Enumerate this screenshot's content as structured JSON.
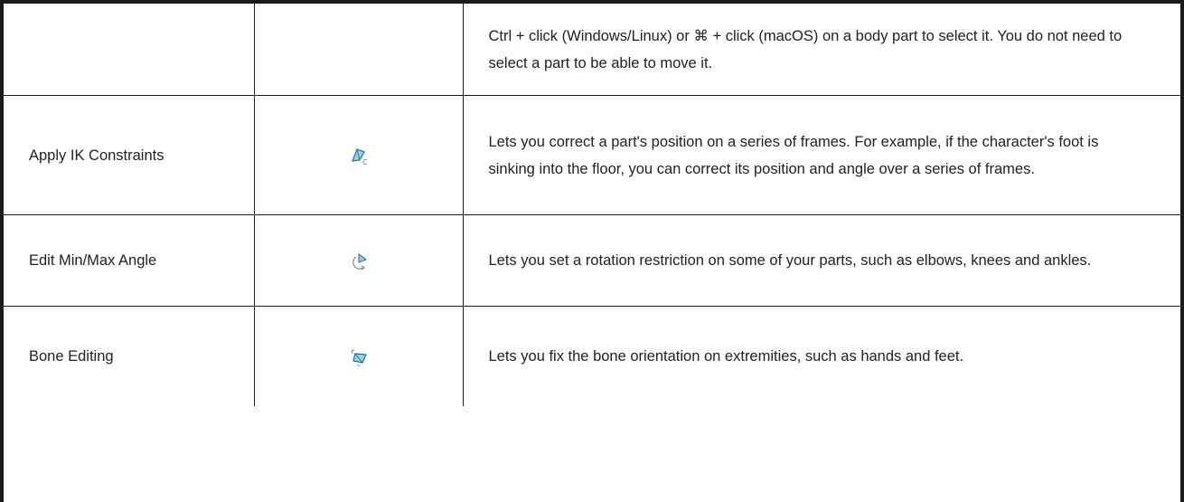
{
  "rows": [
    {
      "tool": "",
      "icon": "",
      "description": "Ctrl + click (Windows/Linux) or ⌘ + click (macOS) on a body part to select it. You do not need to select a part to be able to move it."
    },
    {
      "tool": "Apply IK Constraints",
      "icon": "apply-ik-constraints-icon",
      "description": "Lets you correct a part's position on a series of frames. For example, if the character's foot is sinking into the floor, you can correct its position and angle over a series of frames."
    },
    {
      "tool": "Edit Min/Max Angle",
      "icon": "min-max-angle-icon",
      "description": "Lets you set a rotation restriction on some of your parts, such as elbows, knees and ankles."
    },
    {
      "tool": "Bone Editing",
      "icon": "bone-editing-icon",
      "description": "Lets you fix the bone orientation on extremities, such as hands and feet."
    }
  ],
  "colors": {
    "border": "#1a1a1a",
    "icon_fill": "#8fd3f0",
    "icon_stroke": "#2a6f8e"
  }
}
